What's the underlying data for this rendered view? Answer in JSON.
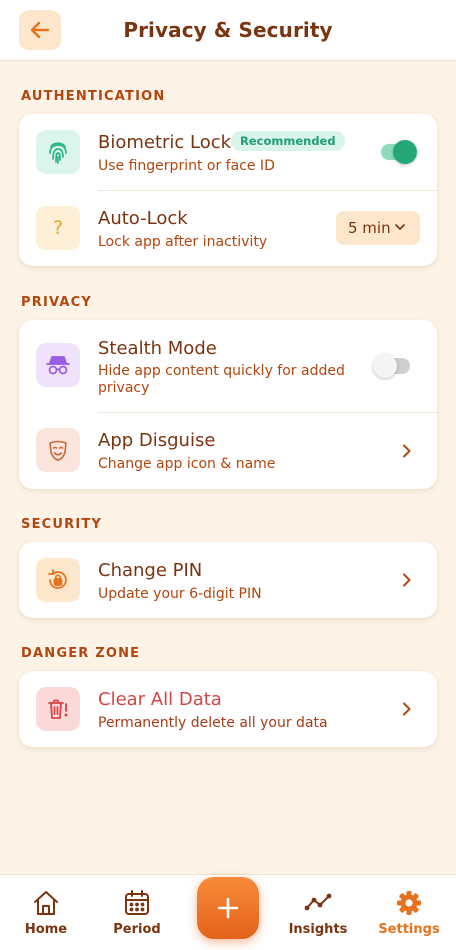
{
  "header": {
    "title": "Privacy & Security"
  },
  "sections": {
    "authentication": "AUTHENTICATION",
    "privacy": "PRIVACY",
    "security": "SECURITY",
    "danger": "DANGER ZONE"
  },
  "biometric": {
    "title": "Biometric Lock",
    "badge": "Recommended",
    "subtitle": "Use fingerprint or face ID",
    "enabled": true
  },
  "autolock": {
    "title": "Auto-Lock",
    "subtitle": "Lock app after inactivity",
    "value": "5 min",
    "icon_glyph": "?"
  },
  "stealth": {
    "title": "Stealth Mode",
    "subtitle_line1": "Hide app content quickly for added",
    "subtitle_line2": "privacy",
    "enabled": false
  },
  "disguise": {
    "title": "App Disguise",
    "subtitle": "Change app icon & name"
  },
  "pin": {
    "title": "Change PIN",
    "subtitle": "Update your 6-digit PIN"
  },
  "clear": {
    "title": "Clear All Data",
    "subtitle": "Permanently delete all your data"
  },
  "nav": {
    "home": "Home",
    "period": "Period",
    "insights": "Insights",
    "settings": "Settings",
    "active": "settings"
  },
  "colors": {
    "background": "#fdf3e6",
    "accent": "#e8711d",
    "text": "#7a3410",
    "subtext": "#b3450e",
    "success": "#1f9e73",
    "danger": "#d64545"
  },
  "icons": {
    "back": "arrow-left-icon",
    "biometric": "fingerprint-icon",
    "autolock": "question-mark-icon",
    "stealth": "incognito-icon",
    "disguise": "theater-mask-icon",
    "pin": "lock-rotate-icon",
    "clear": "trash-alert-icon",
    "home": "home-icon",
    "period": "calendar-icon",
    "insights": "trend-line-icon",
    "settings": "gear-icon",
    "add": "plus-icon"
  }
}
